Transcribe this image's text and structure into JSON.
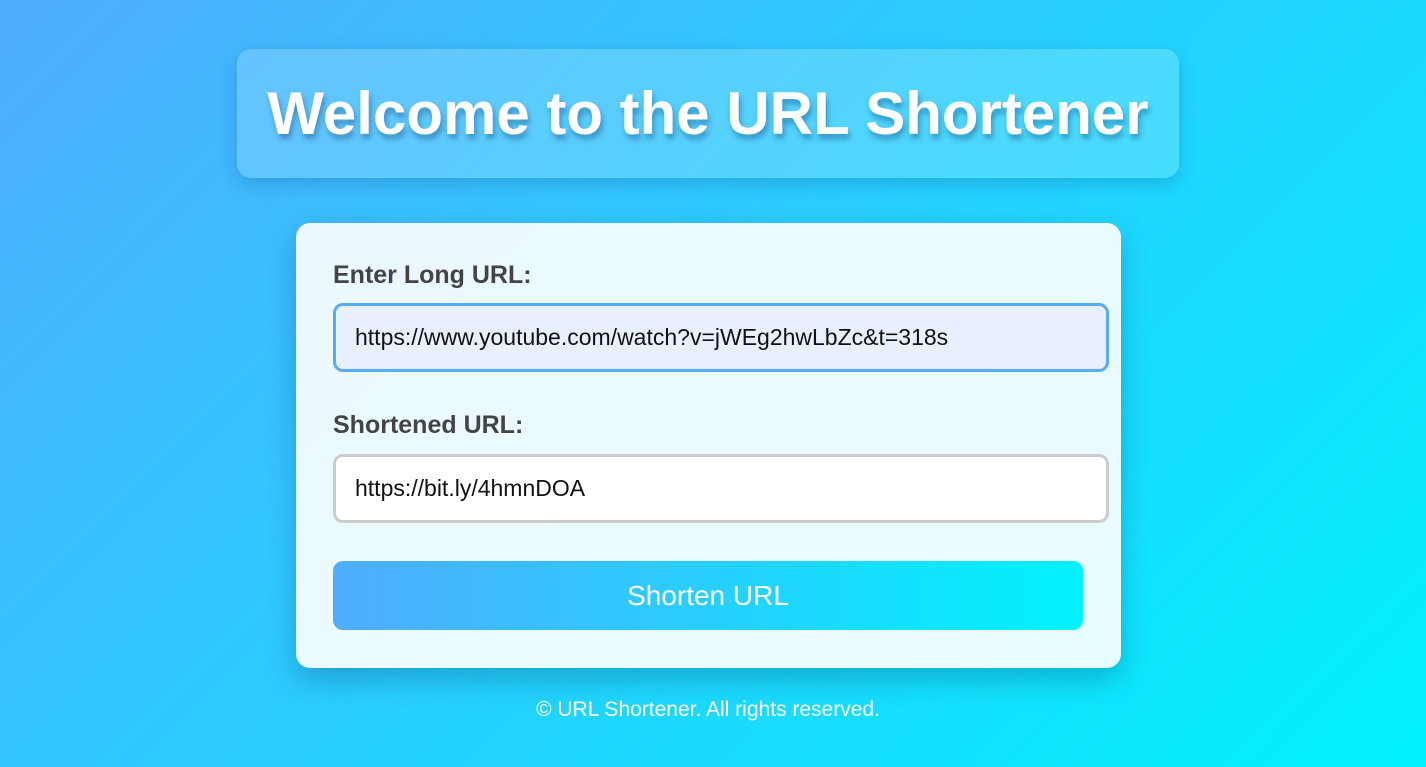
{
  "header": {
    "title": "Welcome to the URL Shortener"
  },
  "form": {
    "long_url_label": "Enter Long URL:",
    "long_url_value": "https://www.youtube.com/watch?v=jWEg2hwLbZc&t=318s",
    "short_url_label": "Shortened URL:",
    "short_url_value": "https://bit.ly/4hmnDOA",
    "submit_label": "Shorten URL"
  },
  "footer": {
    "text": "© URL Shortener. All rights reserved."
  },
  "colors": {
    "gradient_start": "#4facfe",
    "gradient_end": "#00f2fe",
    "label_text": "#444444",
    "focus_border": "#57acf5"
  }
}
